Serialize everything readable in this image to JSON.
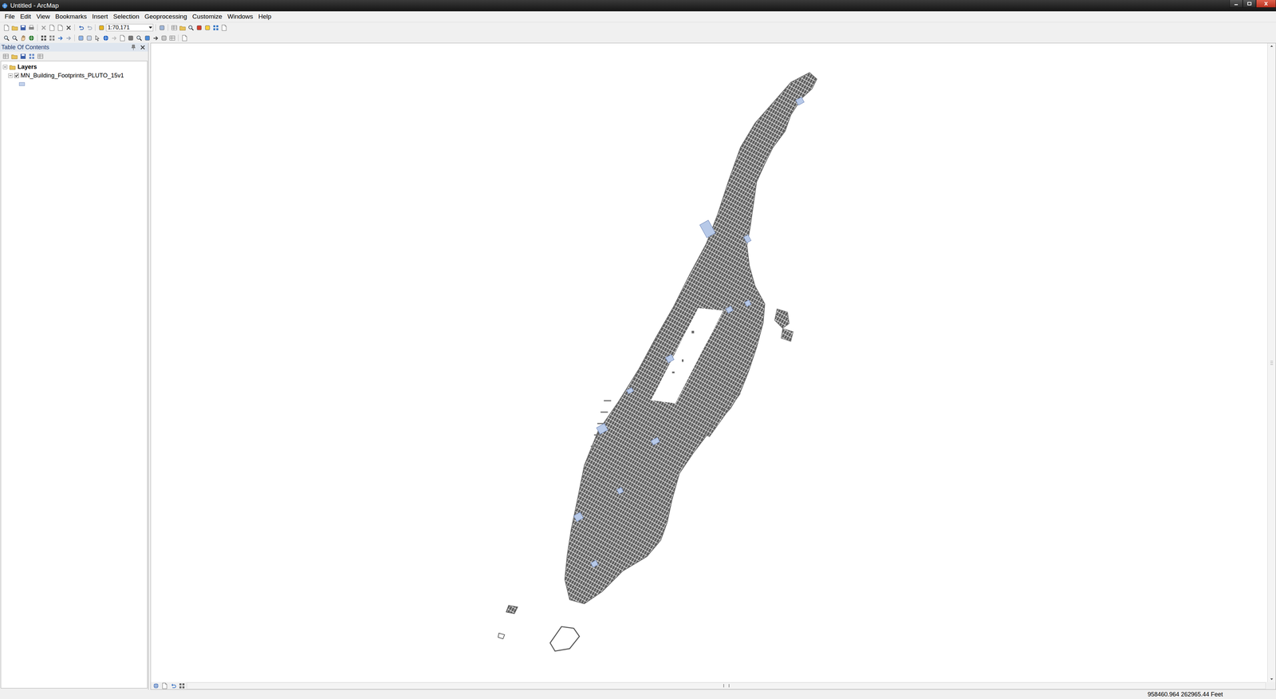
{
  "window": {
    "title": "Untitled - ArcMap"
  },
  "menu": [
    "File",
    "Edit",
    "View",
    "Bookmarks",
    "Insert",
    "Selection",
    "Geoprocessing",
    "Customize",
    "Windows",
    "Help"
  ],
  "toolbar": {
    "scale": "1:70,171"
  },
  "toc": {
    "title": "Table Of Contents",
    "tree": [
      {
        "label": "Layers",
        "kind": "frame",
        "expanded": true
      },
      {
        "label": "MN_Building_Footprints_PLUTO_15v1",
        "kind": "layer",
        "expanded": true,
        "checked": true
      }
    ]
  },
  "status_bar": {
    "coordinates": "958460.964  262965.44 Feet"
  }
}
